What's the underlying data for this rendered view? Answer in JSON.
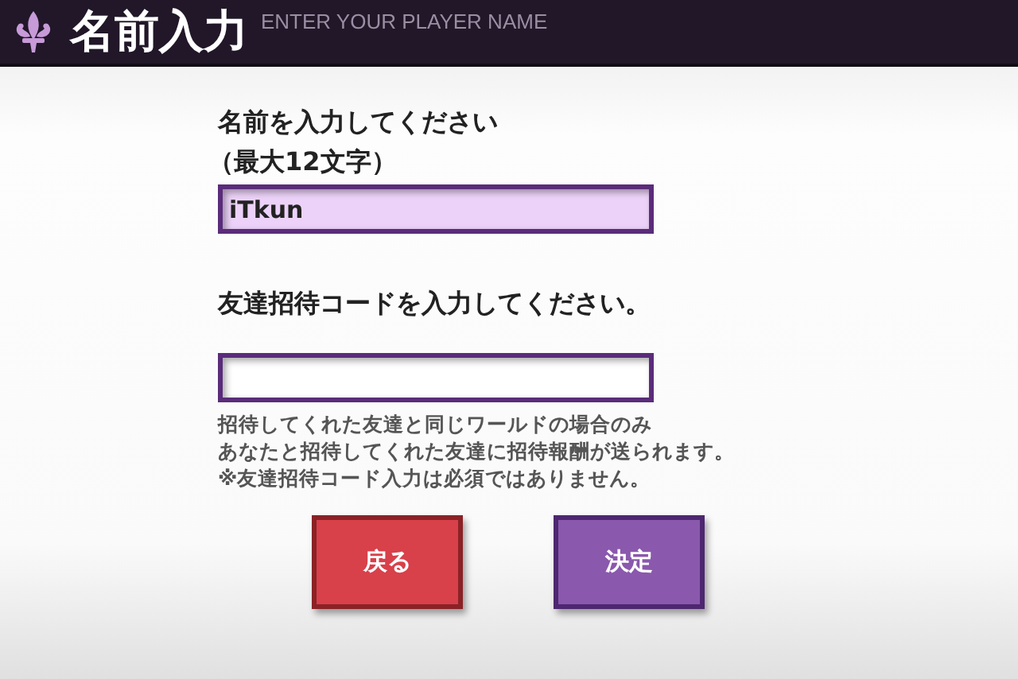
{
  "header": {
    "title": "名前入力",
    "subtitle": "ENTER YOUR PLAYER NAME"
  },
  "name_section": {
    "label": "名前を入力してください",
    "hint": "（最大12文字）",
    "field": {
      "value": "iTkun",
      "highlighted": true
    }
  },
  "code_section": {
    "label": "友達招待コードを入力してください。",
    "field": {
      "highlighted": false
    },
    "notes": [
      "招待してくれた友達と同じワールドの場合のみ",
      "あなたと招待してくれた友達に招待報酬が送られます。",
      "※友達招待コード入力は必須ではありません。"
    ]
  },
  "buttons": [
    {
      "label": "戻る",
      "kind": "back"
    },
    {
      "label": "決定",
      "kind": "confirm"
    }
  ]
}
